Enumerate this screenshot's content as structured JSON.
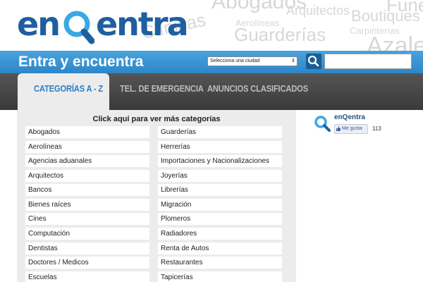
{
  "header": {
    "logo": {
      "before": "en",
      "after": "entra"
    },
    "background_words": [
      "Abogados",
      "Funer",
      "Arquitectos",
      "Boutiques",
      "Aerolíneas",
      "Carpinterías",
      "Clínicas",
      "Guarderías",
      "Azaler"
    ],
    "colors": {
      "logo_blue": "#1f5fa0",
      "logo_cyan": "#39a9e3",
      "bar_blue": "#2c86c8"
    }
  },
  "bar": {
    "tagline": "Entra y encuentra",
    "city_select": "Selecciona una ciudad",
    "search_icon": "search-icon",
    "search_value": ""
  },
  "tabs": [
    {
      "label": "CATEGORÍAS A - Z",
      "active": true
    },
    {
      "label": "TEL. DE EMERGENCIA",
      "active": false
    },
    {
      "label": "ANUNCIOS CLASIFICADOS",
      "active": false
    }
  ],
  "categories": {
    "header": "Click aquí para ver más categorías",
    "left": [
      "Abogados",
      "Aerolíneas",
      "Agencias aduanales",
      "Arquitectos",
      "Bancos",
      "Bienes raíces",
      "Cines",
      "Computación",
      "Dentistas",
      "Doctores / Medicos",
      "Escuelas"
    ],
    "right": [
      "Guarderías",
      "Herrerías",
      "Importaciones y Nacionalizaciones",
      "Joyerías",
      "Librerías",
      "Migración",
      "Plomeros",
      "Radiadores",
      "Renta de Autos",
      "Restaurantes",
      "Tapicerías"
    ]
  },
  "facebook": {
    "page_name": "enQentra",
    "like_label": "Me gusta",
    "like_count": "113",
    "like_icon": "thumbs-up-icon"
  }
}
